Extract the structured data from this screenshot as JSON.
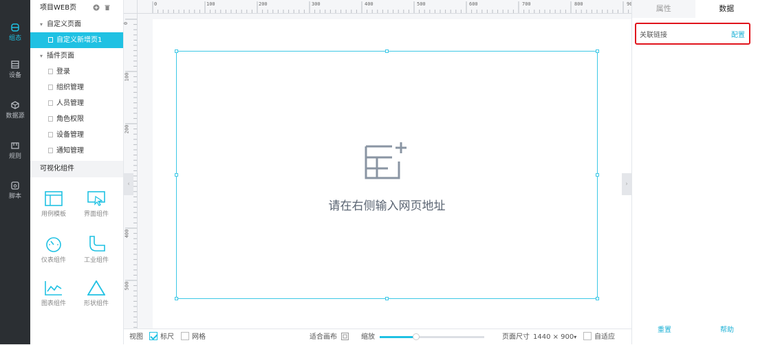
{
  "nav": {
    "items": [
      {
        "label": "组态",
        "icon": "layers-icon",
        "active": true
      },
      {
        "label": "设备",
        "icon": "device-icon",
        "active": false
      },
      {
        "label": "数据源",
        "icon": "cube-icon",
        "active": false
      },
      {
        "label": "规则",
        "icon": "rule-icon",
        "active": false
      },
      {
        "label": "脚本",
        "icon": "script-icon",
        "active": false
      }
    ]
  },
  "sidebar": {
    "project_title": "项目WEB页",
    "custom_group": "自定义页面",
    "custom_pages": [
      "自定义新增页1"
    ],
    "plugin_group": "插件页面",
    "plugin_pages": [
      "登录",
      "组织管理",
      "人员管理",
      "角色权限",
      "设备管理",
      "通知管理"
    ],
    "components_title": "可视化组件",
    "components": [
      {
        "label": "用例模板",
        "icon": "template-icon"
      },
      {
        "label": "界面组件",
        "icon": "ui-cursor-icon"
      },
      {
        "label": "仪表组件",
        "icon": "gauge-icon"
      },
      {
        "label": "工业组件",
        "icon": "pipe-icon"
      },
      {
        "label": "图表组件",
        "icon": "chart-icon"
      },
      {
        "label": "形状组件",
        "icon": "triangle-icon"
      }
    ]
  },
  "rulers": {
    "top": [
      "0",
      "100",
      "200",
      "300",
      "400",
      "500",
      "600",
      "700",
      "800",
      "90"
    ],
    "left": [
      "0",
      "100",
      "200",
      "300",
      "400",
      "500"
    ]
  },
  "canvas": {
    "placeholder": "请在右侧输入网页地址"
  },
  "bottombar": {
    "view_label": "视图",
    "ruler_label": "标尺",
    "ruler_checked": true,
    "grid_label": "网格",
    "grid_checked": false,
    "fit_label": "适合画布",
    "zoom_label": "缩放",
    "zoom_fraction": 0.35,
    "page_size_label": "页面尺寸",
    "page_size_value": "1440 × 900",
    "adaptive_label": "自适应",
    "adaptive_checked": false
  },
  "right_panel": {
    "tabs": [
      "属性",
      "数据"
    ],
    "active_tab": "数据",
    "link_label": "关联链接",
    "config_label": "配置",
    "reset_label": "重置",
    "help_label": "帮助"
  },
  "colors": {
    "accent": "#1fc1e3",
    "nav_bg": "#2b2f33",
    "highlight_border": "#e0141c"
  }
}
